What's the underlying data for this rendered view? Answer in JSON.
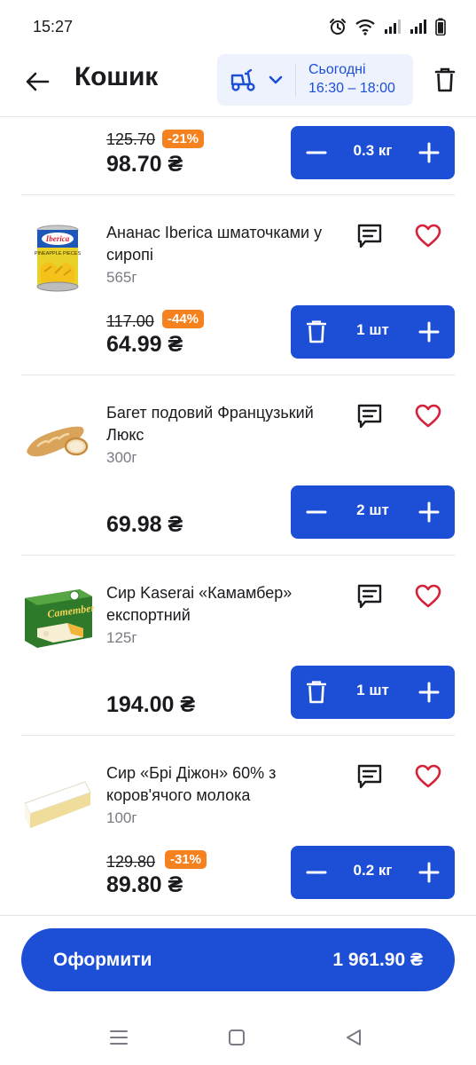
{
  "status": {
    "time": "15:27"
  },
  "header": {
    "title": "Кошик",
    "delivery_day": "Сьогодні",
    "delivery_time": "16:30 – 18:00"
  },
  "currency": "₴",
  "items": [
    {
      "old_price": "125.70",
      "discount": "-21%",
      "price": "98.70 ₴",
      "quantity": "0.3 кг",
      "minus_icon": "minus-icon"
    },
    {
      "name": "Ананас Iberica шматочками у сиропі",
      "weight": "565г",
      "old_price": "117.00",
      "discount": "-44%",
      "price": "64.99 ₴",
      "quantity": "1 шт",
      "minus_icon": "trash-icon"
    },
    {
      "name": "Багет подовий Французький Люкс",
      "weight": "300г",
      "price": "69.98 ₴",
      "quantity": "2 шт",
      "minus_icon": "minus-icon"
    },
    {
      "name": "Сир Kaserai «Камамбер» експортний",
      "weight": "125г",
      "price": "194.00 ₴",
      "quantity": "1 шт",
      "minus_icon": "trash-icon"
    },
    {
      "name": "Сир «Брі Діжон» 60% з коров'ячого молока",
      "weight": "100г",
      "old_price": "129.80",
      "discount": "-31%",
      "price": "89.80 ₴",
      "quantity": "0.2 кг",
      "minus_icon": "minus-icon"
    }
  ],
  "product_images": {
    "pineapple": {
      "brand": "Iberica",
      "caption": "PINEAPPLE PIECES"
    },
    "camembert": {
      "brand": "Camembert"
    }
  },
  "checkout": {
    "label": "Оформити",
    "total": "1 961.90 ₴"
  },
  "colors": {
    "primary": "#1c4fd6",
    "discount_badge": "#f5821f",
    "favorite": "#d4223a",
    "delivery_bg": "#edf2fc"
  }
}
